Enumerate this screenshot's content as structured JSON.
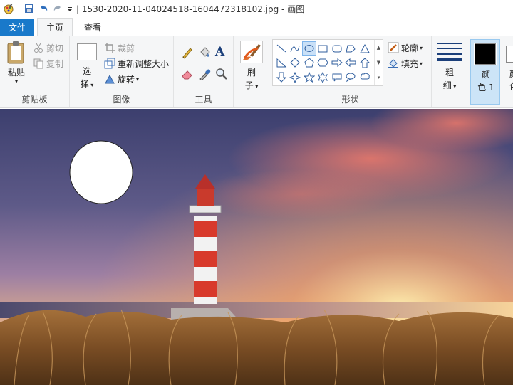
{
  "window": {
    "title": "| 1530-2020-11-04024518-1604472318102.jpg - 画图"
  },
  "tabs": {
    "file": "文件",
    "home": "主页",
    "view": "查看"
  },
  "clipboard": {
    "paste": "粘贴",
    "cut": "剪切",
    "copy": "复制",
    "label": "剪贴板"
  },
  "image": {
    "select_line1": "选",
    "select_line2": "择",
    "crop": "裁剪",
    "resize": "重新调整大小",
    "rotate": "旋转",
    "label": "图像"
  },
  "tools": {
    "label": "工具"
  },
  "brushes": {
    "line1": "刷",
    "line2": "子"
  },
  "shapes": {
    "outline": "轮廓",
    "fill": "填充",
    "label": "形状"
  },
  "size": {
    "line1": "粗",
    "line2": "细"
  },
  "color1": {
    "line1": "颜",
    "line2": "色 1",
    "value": "#000000"
  },
  "color2": {
    "line1": "颜",
    "line2": "色"
  },
  "colors": {
    "accent": "#1979ca",
    "ribbon_bg": "#f5f6f7",
    "selected": "#cce4f7"
  }
}
